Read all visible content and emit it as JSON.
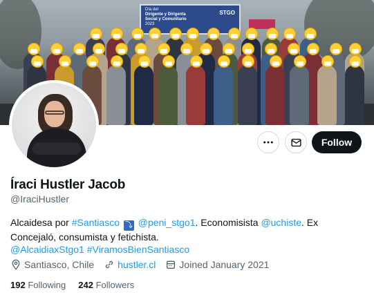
{
  "banner": {
    "sign_line1": "Día del",
    "sign_line2": "Dirigente y Dirigenta",
    "sign_line3": "Social y Comunitario",
    "sign_logo": "STGO",
    "sign_year": "2023"
  },
  "profile": {
    "name": "Íraci Hustler Jacob",
    "handle": "@IraciHustler",
    "bio": {
      "t1": "Alcaidesa por ",
      "l1": "#Santiasco",
      "emoji": "⤵",
      "l2": "@peni_stgo1",
      "t2": ". Economisista ",
      "l3": "@uchiste",
      "t3": ". Ex Concejaló, consumista y fetichista.",
      "l4": "@AlcaidiaxStgo1",
      "t4": " ",
      "l5": "#ViramosBienSantiasco"
    },
    "location": "Santiasco, Chile",
    "website": "hustler.cl",
    "joined": "Joined January 2021",
    "following_count": "192",
    "following_label": "Following",
    "followers_count": "242",
    "followers_label": "Followers"
  },
  "actions": {
    "follow_label": "Follow",
    "more_icon": "more-icon",
    "message_icon": "envelope-icon"
  },
  "colors": {
    "accent": "#1d9bf0",
    "text": "#0f1419",
    "muted": "#536471",
    "follow_bg": "#0f1419"
  }
}
